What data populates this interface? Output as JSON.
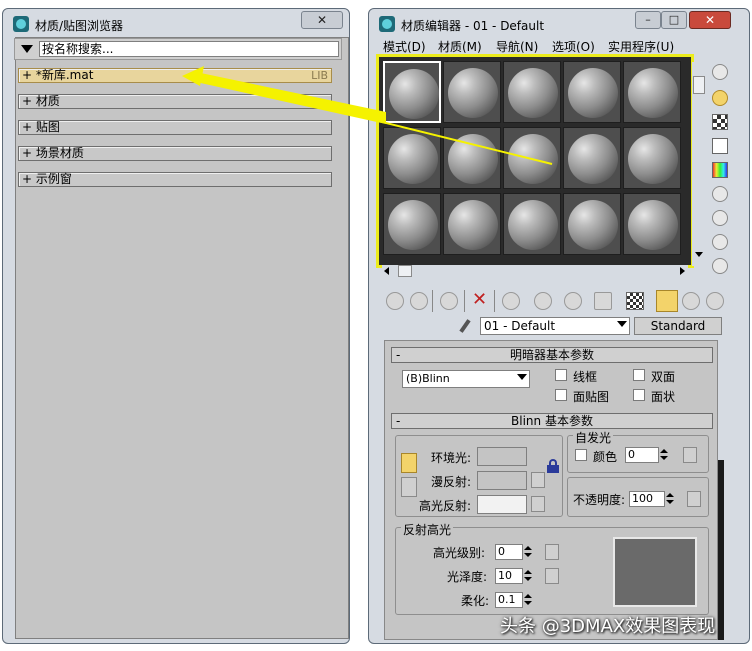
{
  "browser": {
    "title": "材质/贴图浏览器",
    "close_label": "✕",
    "search_value": "按名称搜索...",
    "rollouts": [
      {
        "label": "+ *新库.mat",
        "tag": "LIB"
      },
      {
        "label": "+ 材质"
      },
      {
        "label": "+ 贴图"
      },
      {
        "label": "+ 场景材质"
      },
      {
        "label": "+ 示例窗"
      }
    ]
  },
  "editor": {
    "title": "材质编辑器 - 01 - Default",
    "minimize_label": "–",
    "maximize_label": "□",
    "close_label": "✕",
    "menu": [
      "模式(D)",
      "材质(M)",
      "导航(N)",
      "选项(O)",
      "实用程序(U)"
    ],
    "material_name": "01 - Default",
    "material_type": "Standard",
    "shader_rollout": {
      "title": "明暗器基本参数",
      "shader": "(B)Blinn",
      "checkboxes": [
        "线框",
        "双面",
        "面贴图",
        "面状"
      ]
    },
    "blinn_rollout": {
      "title": "Blinn 基本参数",
      "ambient_label": "环境光:",
      "diffuse_label": "漫反射:",
      "specular_label": "高光反射:",
      "self_illum_label": "自发光",
      "color_label": "颜色",
      "color_value": "0",
      "opacity_label": "不透明度:",
      "opacity_value": "100",
      "spec_title": "反射高光",
      "spec_level_label": "高光级别:",
      "spec_level_value": "0",
      "gloss_label": "光泽度:",
      "gloss_value": "10",
      "soften_label": "柔化:",
      "soften_value": "0.1"
    },
    "colors": {
      "ambient": "#c4c4c4",
      "diffuse": "#c4c4c4",
      "specular": "#f2f2f2",
      "spec_curve": "#6a6a6a",
      "highlight": "#ecec1c"
    }
  },
  "watermark": "头条 @3DMAX效果图表现"
}
